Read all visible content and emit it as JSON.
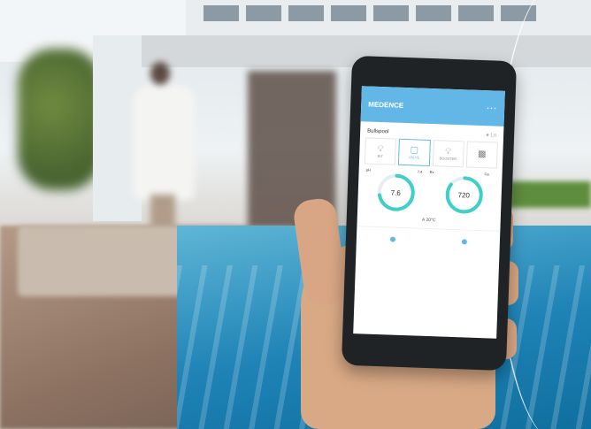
{
  "app": {
    "title": "MEDENCE",
    "menu_icon": "more-icon",
    "section_title": "Bullspool",
    "section_status": "● Ln"
  },
  "tiles": [
    {
      "label": "BIT",
      "icon": "bulb-icon",
      "active": false
    },
    {
      "label": "VALVE",
      "icon": "valve-icon",
      "active": true
    },
    {
      "label": "BOOSTER",
      "icon": "bulb-icon",
      "active": false
    },
    {
      "label": "",
      "icon": "device-icon",
      "active": false
    }
  ],
  "gauges": [
    {
      "tag_left": "pH",
      "tag_right": "7.4",
      "value": "7.6",
      "level": 0.72
    },
    {
      "tag_left": "Rx",
      "tag_right": "Ca",
      "value": "720",
      "level": 0.85
    }
  ],
  "temperature": "A 20°C",
  "bottom_nav": [
    "home-icon",
    "settings-icon"
  ],
  "colors": {
    "accent": "#63b7e6",
    "pool": "#1f83b6"
  }
}
